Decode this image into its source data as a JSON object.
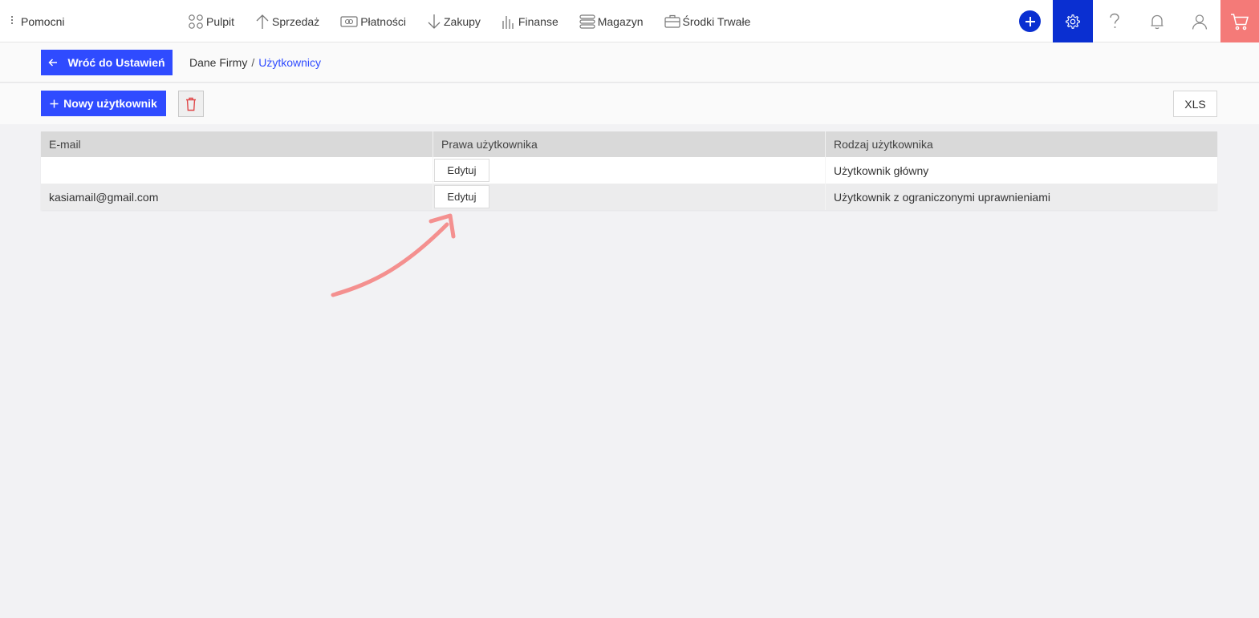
{
  "header": {
    "brand": "Pomocni",
    "nav": [
      {
        "label": "Pulpit",
        "icon": "grid-circles-icon"
      },
      {
        "label": "Sprzedaż",
        "icon": "arrow-up-icon"
      },
      {
        "label": "Płatności",
        "icon": "payment-card-icon"
      },
      {
        "label": "Zakupy",
        "icon": "arrow-down-icon"
      },
      {
        "label": "Finanse",
        "icon": "bar-chart-icon"
      },
      {
        "label": "Magazyn",
        "icon": "stack-icon"
      },
      {
        "label": "Środki Trwałe",
        "icon": "briefcase-icon"
      }
    ],
    "right_icons": [
      "plus-icon",
      "gear-icon",
      "question-icon",
      "bell-icon",
      "user-icon",
      "cart-icon"
    ],
    "colors": {
      "accent": "#0a2fd1",
      "cart": "#f47a78"
    }
  },
  "breadcrumb": {
    "back_label": "Wróć do Ustawień",
    "first": "Dane Firmy",
    "separator": "/",
    "current": "Użytkownicy"
  },
  "toolbar": {
    "new_user_label": "Nowy użytkownik",
    "xls_label": "XLS"
  },
  "table": {
    "columns": [
      "E-mail",
      "Prawa użytkownika",
      "Rodzaj użytkownika"
    ],
    "rows": [
      {
        "email": "",
        "rights_button": "Edytuj",
        "type": "Użytkownik główny"
      },
      {
        "email": "kasiamail@gmail.com",
        "rights_button": "Edytuj",
        "type": "Użytkownik z ograniczonymi uprawnieniami"
      }
    ]
  },
  "annotation": {
    "color": "#f4908f"
  }
}
